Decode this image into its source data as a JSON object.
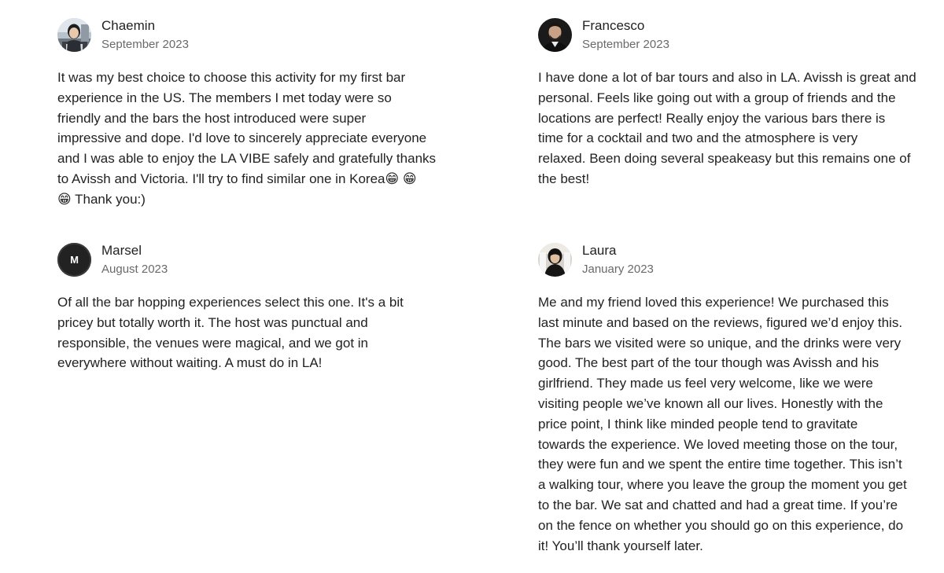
{
  "reviews": [
    {
      "name": "Chaemin",
      "date": "September 2023",
      "avatar_icon": "user-photo-icon",
      "text": "It was my best choice to choose this activity for my first bar\nexperience in the US. The members I met today were so\nfriendly and the bars the host introduced were super\nimpressive and dope. I'd love to sincerely appreciate everyone\nand I was able to enjoy the LA VIBE safely and gratefully thanks\nto Avissh and Victoria. I'll try to find similar one in Korea😁 😁\n😁 Thank you:)"
    },
    {
      "name": "Francesco",
      "date": "September 2023",
      "avatar_icon": "user-photo-icon",
      "text": "I have done a lot of bar tours and also in LA. Avissh is great and\npersonal. Feels like going out with a group of friends and the\nlocations are perfect! Really enjoy the various bars there is\ntime for a cocktail and two and the atmosphere is very\nrelaxed. Been doing several speakeasy but this remains one of\nthe best!"
    },
    {
      "name": "Marsel",
      "date": "August 2023",
      "avatar_initial": "M",
      "avatar_icon": "user-initial-avatar",
      "text": "Of all the bar hopping experiences select this one. It's a bit\npricey but totally worth it. The host was punctual and\nresponsible, the venues were magical, and we got in\neverywhere without waiting. A must do in LA!"
    },
    {
      "name": "Laura",
      "date": "January 2023",
      "avatar_icon": "user-photo-icon",
      "text": "Me and my friend loved this experience! We purchased this\nlast minute and based on the reviews, figured we’d enjoy this.\nThe bars we visited were so unique, and the drinks were very\ngood. The best part of the tour though was Avissh and his\ngirlfriend. They made us feel very welcome, like we were\nvisiting people we’ve known all our lives. Honestly with the\nprice point, I think like minded people tend to gravitate\ntowards the experience. We loved meeting those on the tour,\nthey were fun and we spent the entire time together. This isn’t\na walking tour, where you leave the group the moment you get\nto the bar. We sat and chatted and had a great time. If you’re\non the fence on whether you should go on this experience, do\nit! You’ll thank yourself later."
    }
  ]
}
